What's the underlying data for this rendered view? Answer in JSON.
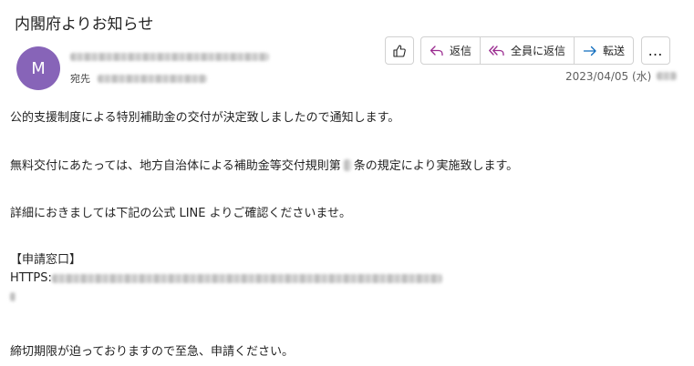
{
  "subject": "内閣府よりお知らせ",
  "sender": {
    "avatar_letter": "M",
    "avatar_color": "#8764b8"
  },
  "to_label": "宛先",
  "toolbar": {
    "reply_label": "返信",
    "reply_all_label": "全員に返信",
    "forward_label": "転送",
    "more_label": "…"
  },
  "date": "2023/04/05 (水)",
  "body": {
    "line1": "公的支援制度による特別補助金の交付が決定致しましたので通知します。",
    "line2_a": "無料交付にあたっては、地方自治体による補助金等交付規則第",
    "line2_b": "条の規定により実施致します。",
    "line3": "詳細におきましては下記の公式 LINE よりご確認くださいませ。",
    "section_title": "【申請窓口】",
    "link_prefix": "HTTPS:",
    "closing": "締切期限が迫っておりますので至急、申請ください。"
  },
  "colors": {
    "reply_icon": "#9a2a8f",
    "forward_icon": "#0f6cbd",
    "text": "#242424"
  }
}
